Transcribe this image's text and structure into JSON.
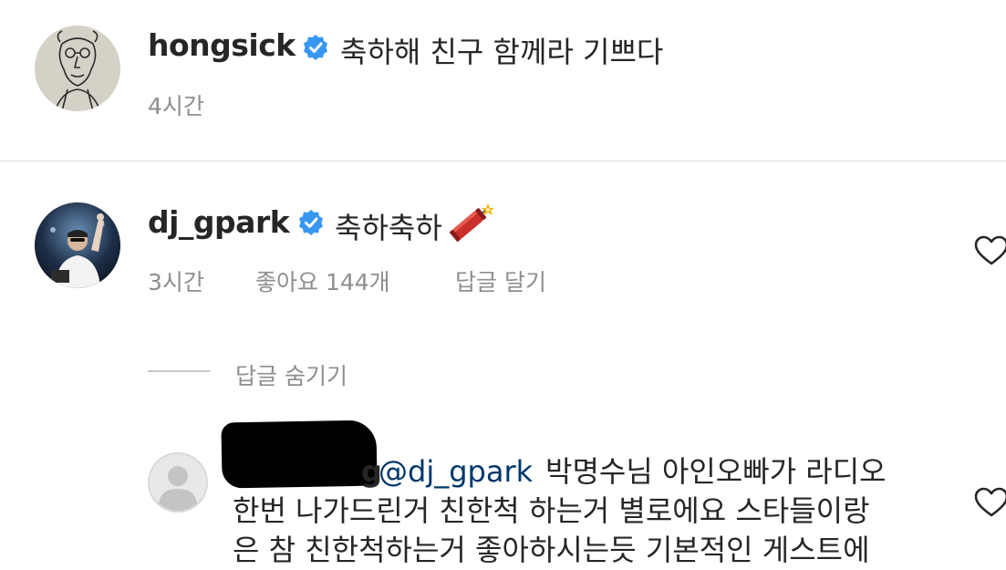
{
  "comments": [
    {
      "username": "hongsick",
      "verified": true,
      "text": "축하해 친구 함께라 기쁘다",
      "time": "4시간"
    },
    {
      "username": "dj_gpark",
      "verified": true,
      "text": "축하축하",
      "emoji": "🧨",
      "time": "3시간",
      "likes": "좋아요 144개",
      "reply_label": "답글 달기"
    }
  ],
  "replies_toggle": "답글 숨기기",
  "reply": {
    "username_partial": "g",
    "mention": "@dj_gpark",
    "line1": "박명수님 아인오빠가 라디오",
    "line2": "한번 나가드린거 친한척 하는거 별로에요 스타들이랑",
    "line3": "은 참 친한척하는거 좋아하시는듯 기본적인 게스트에"
  },
  "colors": {
    "verified": "#3897f0",
    "meta": "#8e8e8e",
    "mention": "#00376b"
  }
}
